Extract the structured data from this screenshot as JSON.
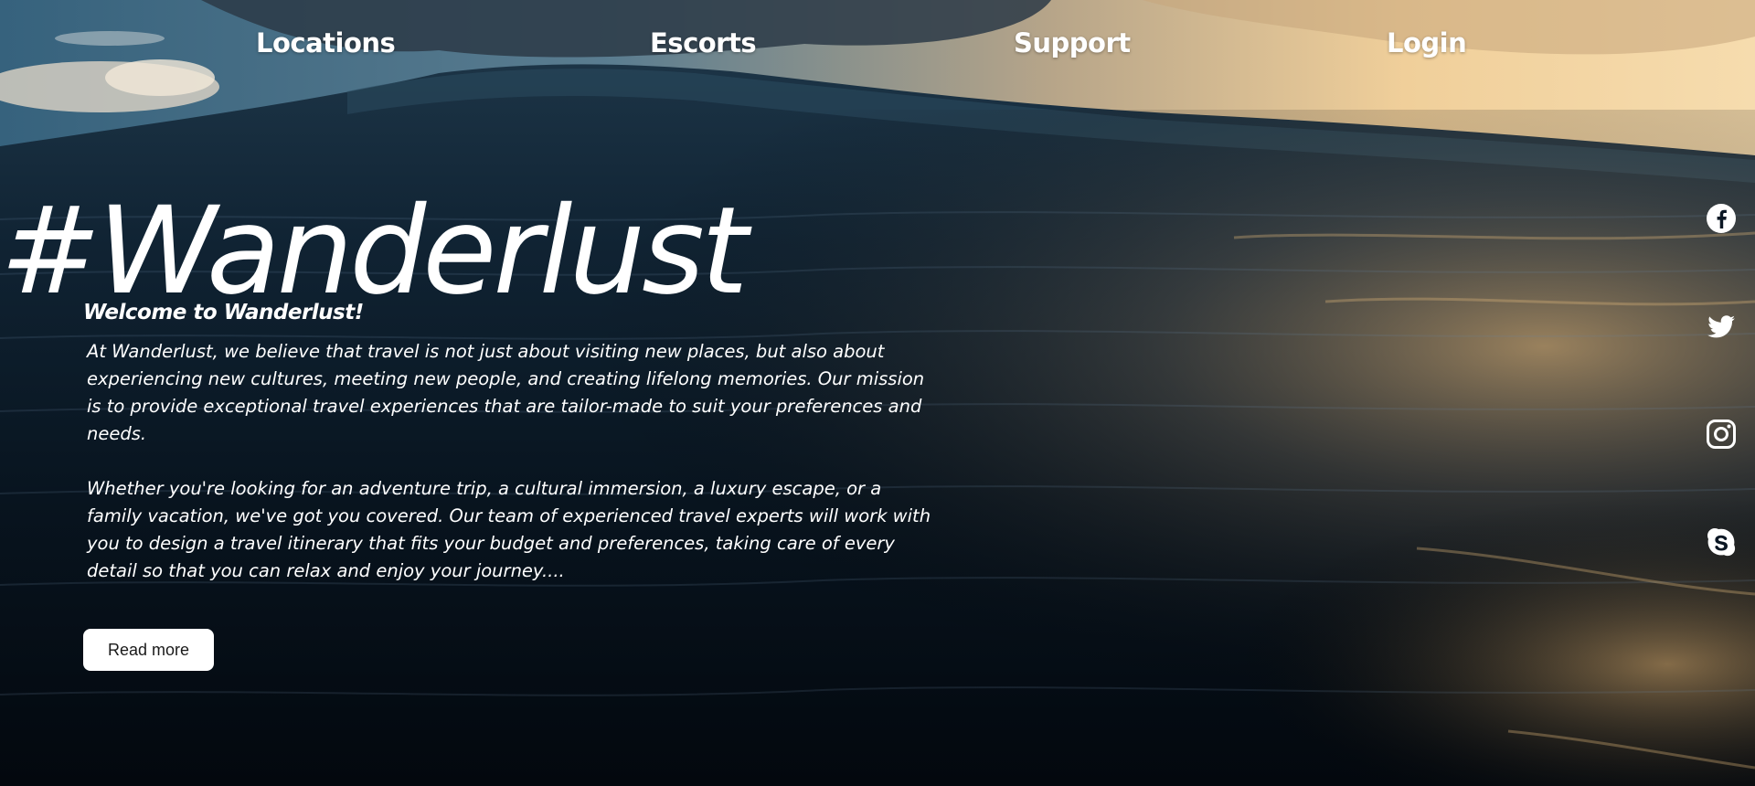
{
  "nav": {
    "items": [
      {
        "label": "Locations"
      },
      {
        "label": "Escorts"
      },
      {
        "label": "Support"
      },
      {
        "label": "Login"
      }
    ]
  },
  "hero": {
    "title": "#Wanderlust",
    "welcome": "Welcome to Wanderlust!",
    "paragraphs": [
      "At Wanderlust, we believe that travel is not just about visiting new places, but also about experiencing new cultures, meeting new people, and creating lifelong memories. Our mission is to provide exceptional travel experiences that are tailor-made to suit your preferences and needs.",
      "Whether you're looking for an adventure trip, a cultural immersion, a luxury escape, or a family vacation, we've got you covered. Our team of experienced travel experts will work with you to design a travel itinerary that fits your budget and preferences, taking care of every detail so that you can relax and enjoy your journey...."
    ],
    "button_label": "Read more"
  },
  "social": {
    "icons": [
      "facebook-icon",
      "twitter-icon",
      "instagram-icon",
      "skype-icon"
    ]
  },
  "colors": {
    "text": "#ffffff",
    "button_bg": "#ffffff",
    "button_text": "#1a1a1a",
    "ocean_dark": "#050c14",
    "sky_warm": "#f3d3a0"
  }
}
